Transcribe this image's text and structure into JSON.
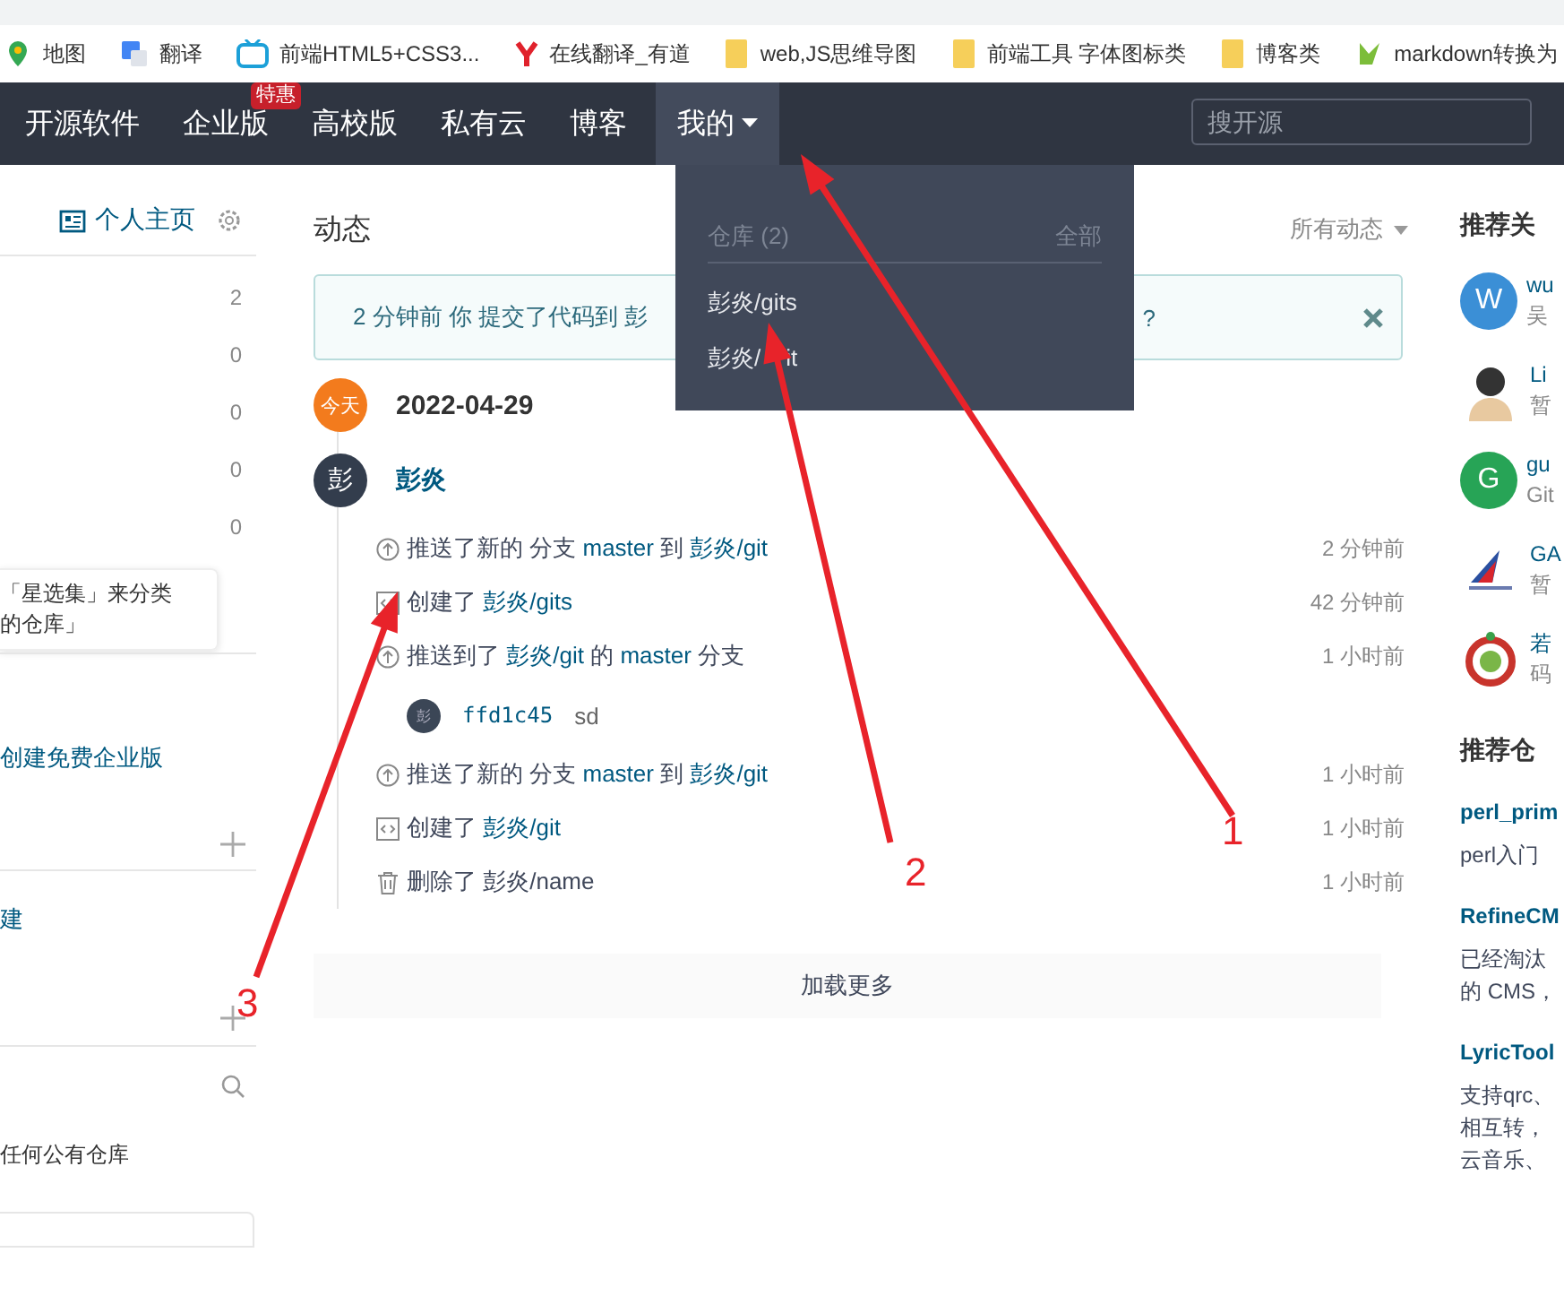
{
  "bookmarks": [
    {
      "kind": "map",
      "label": "地图"
    },
    {
      "kind": "translate",
      "label": "翻译"
    },
    {
      "kind": "tv",
      "label": "前端HTML5+CSS3..."
    },
    {
      "kind": "y",
      "label": "在线翻译_有道"
    },
    {
      "kind": "folder",
      "label": "web,JS思维导图"
    },
    {
      "kind": "folder",
      "label": "前端工具 字体图标类"
    },
    {
      "kind": "folder",
      "label": "博客类"
    },
    {
      "kind": "md",
      "label": "markdown转换为"
    }
  ],
  "nav": {
    "items": [
      {
        "label": "开源软件",
        "selected": false
      },
      {
        "label": "企业版",
        "selected": false,
        "badge": "特惠"
      },
      {
        "label": "高校版",
        "selected": false
      },
      {
        "label": "私有云",
        "selected": false
      },
      {
        "label": "博客",
        "selected": false
      },
      {
        "label": "我的",
        "selected": true
      }
    ],
    "search": {
      "placeholder": "搜开源"
    }
  },
  "dropdown": {
    "header": "仓库 (2)",
    "all_link": "全部",
    "repos": [
      [
        "彭炎/gits"
      ],
      [
        "彭炎/",
        "it"
      ]
    ]
  },
  "sidebar": {
    "profile_link": "个人主页",
    "counts": [
      "2",
      "0",
      "0",
      "0",
      "0"
    ],
    "tooltip_lines": [
      "「星选集」来分类",
      "的仓库」"
    ],
    "enterprise_link": "创建免费企业版",
    "link2": "建",
    "empty_text": "任何公有仓库"
  },
  "feed": {
    "title": "动态",
    "filter": "所有动态",
    "notice": {
      "text": "2 分钟前 你 提交了代码到 彭",
      "tail": "?"
    },
    "date_badge": "今天",
    "date": "2022-04-29",
    "user": {
      "avatar": "彭",
      "name": "彭炎"
    },
    "events": [
      {
        "kind": "push",
        "parts": [
          {
            "text": "推送了新的 分支 ",
            "link": false
          },
          {
            "text": "master",
            "link": true
          },
          {
            "text": " 到 ",
            "link": false
          },
          {
            "text": "彭炎/git",
            "link": true
          }
        ],
        "time": "2 分钟前"
      },
      {
        "kind": "create",
        "parts": [
          {
            "text": "创建了 ",
            "link": false
          },
          {
            "text": "彭炎/gits",
            "link": true
          }
        ],
        "time": "42 分钟前"
      },
      {
        "kind": "push",
        "parts": [
          {
            "text": "推送到了 ",
            "link": false
          },
          {
            "text": "彭炎/git",
            "link": true
          },
          {
            "text": " 的 ",
            "link": false
          },
          {
            "text": "master",
            "link": true
          },
          {
            "text": " 分支",
            "link": false
          }
        ],
        "time": "1 小时前",
        "commits": [
          {
            "avatar": "彭",
            "hash": "ffd1c45",
            "message": "sd"
          }
        ]
      },
      {
        "kind": "push",
        "parts": [
          {
            "text": "推送了新的 分支 ",
            "link": false
          },
          {
            "text": "master",
            "link": true
          },
          {
            "text": " 到 ",
            "link": false
          },
          {
            "text": "彭炎/git",
            "link": true
          }
        ],
        "time": "1 小时前"
      },
      {
        "kind": "create",
        "parts": [
          {
            "text": "创建了 ",
            "link": false
          },
          {
            "text": "彭炎/git",
            "link": true
          }
        ],
        "time": "1 小时前"
      },
      {
        "kind": "delete",
        "parts": [
          {
            "text": "删除了 彭炎/name",
            "link": false
          }
        ],
        "time": "1 小时前"
      }
    ],
    "load_more": "加载更多"
  },
  "right": {
    "follow_title": "推荐关",
    "users": [
      {
        "kind": "letter",
        "avatar": "W",
        "color": "#3b8fd6",
        "name": "wu",
        "sub": "吴"
      },
      {
        "kind": "figure",
        "name": "Li",
        "sub": "暂"
      },
      {
        "kind": "letter",
        "avatar": "G",
        "color": "#27a456",
        "name": "gu",
        "sub": "Git"
      },
      {
        "kind": "plane",
        "name": "GA",
        "sub": "暂"
      },
      {
        "kind": "ring",
        "name": "若",
        "sub": "码"
      }
    ],
    "repos_title": "推荐仓",
    "repos": [
      {
        "name": "perl_prim",
        "lines": [
          "perl入门"
        ]
      },
      {
        "name": "RefineCM",
        "lines": [
          "已经淘汰",
          "的 CMS，"
        ]
      },
      {
        "name": "LyricTool",
        "lines": [
          "支持qrc、",
          "相互转，",
          "云音乐、"
        ]
      }
    ]
  },
  "annotations": [
    "1",
    "2",
    "3"
  ]
}
